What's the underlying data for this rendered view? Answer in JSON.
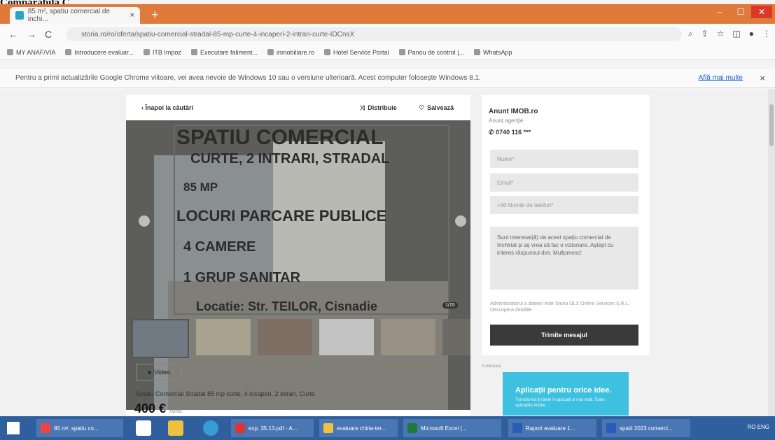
{
  "doc_title": "Comparabila C",
  "browser": {
    "tab_title": "85 m², spatiu comercial de inchi...",
    "tab_close": "×",
    "new_tab": "+",
    "url": "storia.ro/ro/oferta/spatiu-comercial-stradal-85-mp-curte-4-incaperi-2-intrari-curte-IDCnsX",
    "window_buttons": [
      "‒",
      "☐",
      "✕"
    ],
    "nav_back": "←",
    "nav_forward": "→",
    "nav_reload": "C",
    "bookmarks": [
      "MY ANAF/VIA",
      "Introducere evaluar...",
      "ITB Impoz",
      "Executare faliment...",
      "inmobiliare.ro",
      "Hotel Service Portal",
      "Panou de control |...",
      "WhatsApp"
    ],
    "info_bar": "Pentru a primi actualizările Google Chrome viitoare, vei avea nevoie de Windows 10 sau o versiune ulterioară. Acest computer folosește Windows 8.1.",
    "info_more": "Află mai multe",
    "info_close": "×"
  },
  "listing": {
    "back": "Înapoi la căutări",
    "share": "Distribuie",
    "save": "Salvează",
    "hero_lines": [
      "SPATIU COMERCIAL",
      "CURTE, 2 INTRARI, STRADAL",
      "85 MP",
      "LOCURI PARCARE PUBLICE",
      "4 CAMERE",
      "1 GRUP SANITAR",
      "Locatie: Str. TEILOR, Cisnadie"
    ],
    "photo_counter": "1/15",
    "video": "Video",
    "title": "Spatiu Comercial Stradal 85 mp curte, 4 incaperi, 2 intrari, Curte",
    "price": "400 €",
    "price_sub": "/lună"
  },
  "contact": {
    "agency": "Anunt IMOB.ro",
    "agency_sub": "Anunț agenție",
    "phone": "0740 116 ***",
    "name_placeholder": "Nume*",
    "email_placeholder": "Email*",
    "phone_placeholder": "+40   Număr de telefon*",
    "message": "Sunt interesat(ă) de acest spațiu comercial de închiriat și aș vrea să fac o vizionare. Aștept cu interes răspunsul dvs. Mulțumesc!",
    "terms": "Administratorul a datelor este Storia OLX Online Services S.R.L. Descopera detaliile",
    "send": "Trimite mesajul"
  },
  "ad": {
    "label": "Publicitate",
    "title": "Aplicații pentru orice idee.",
    "sub": "Transformă-ți ideile în aplicații și mai mult. Toate aplicațiile Adobe"
  },
  "taskbar": {
    "items": [
      "85 m², spatiu co...",
      "exp. 35.13.pdf - A...",
      "evaluare chiria-ter...",
      "Microsoft Excel (...",
      "Raport evaluare 1...",
      "spatii 2023 comerci..."
    ],
    "tray": "RO  ENG"
  }
}
